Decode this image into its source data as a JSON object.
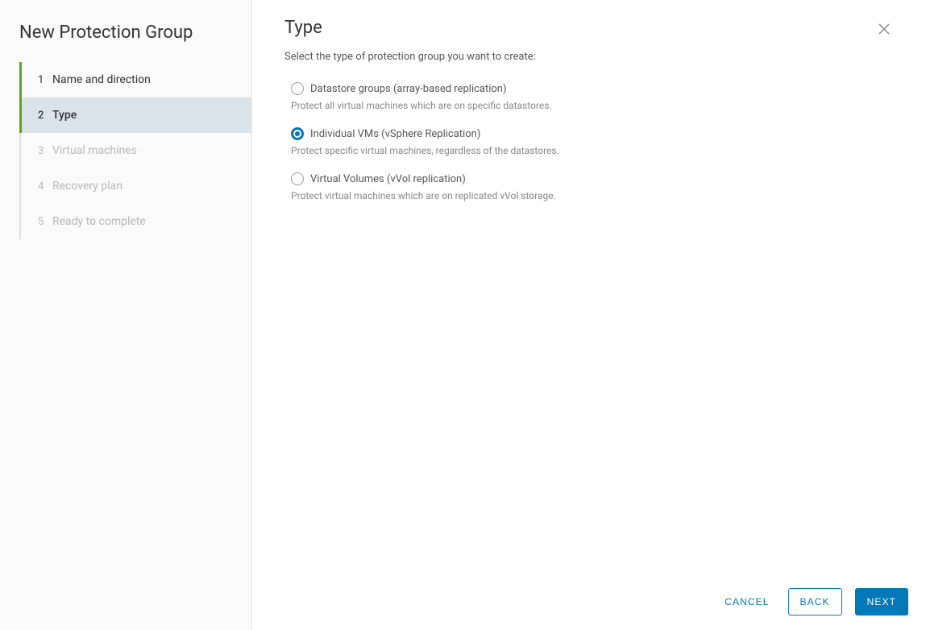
{
  "wizard": {
    "title": "New Protection Group",
    "steps": [
      {
        "num": "1",
        "label": "Name and direction",
        "state": "completed"
      },
      {
        "num": "2",
        "label": "Type",
        "state": "active"
      },
      {
        "num": "3",
        "label": "Virtual machines",
        "state": "pending"
      },
      {
        "num": "4",
        "label": "Recovery plan",
        "state": "pending"
      },
      {
        "num": "5",
        "label": "Ready to complete",
        "state": "pending"
      }
    ]
  },
  "page": {
    "title": "Type",
    "subtitle": "Select the type of protection group you want to create:",
    "options": [
      {
        "label": "Datastore groups (array-based replication)",
        "desc": "Protect all virtual machines which are on specific datastores.",
        "selected": false
      },
      {
        "label": "Individual VMs (vSphere Replication)",
        "desc": "Protect specific virtual machines, regardless of the datastores.",
        "selected": true
      },
      {
        "label": "Virtual Volumes (vVol replication)",
        "desc": "Protect virtual machines which are on replicated vVol storage.",
        "selected": false
      }
    ]
  },
  "footer": {
    "cancel": "Cancel",
    "back": "Back",
    "next": "Next"
  }
}
